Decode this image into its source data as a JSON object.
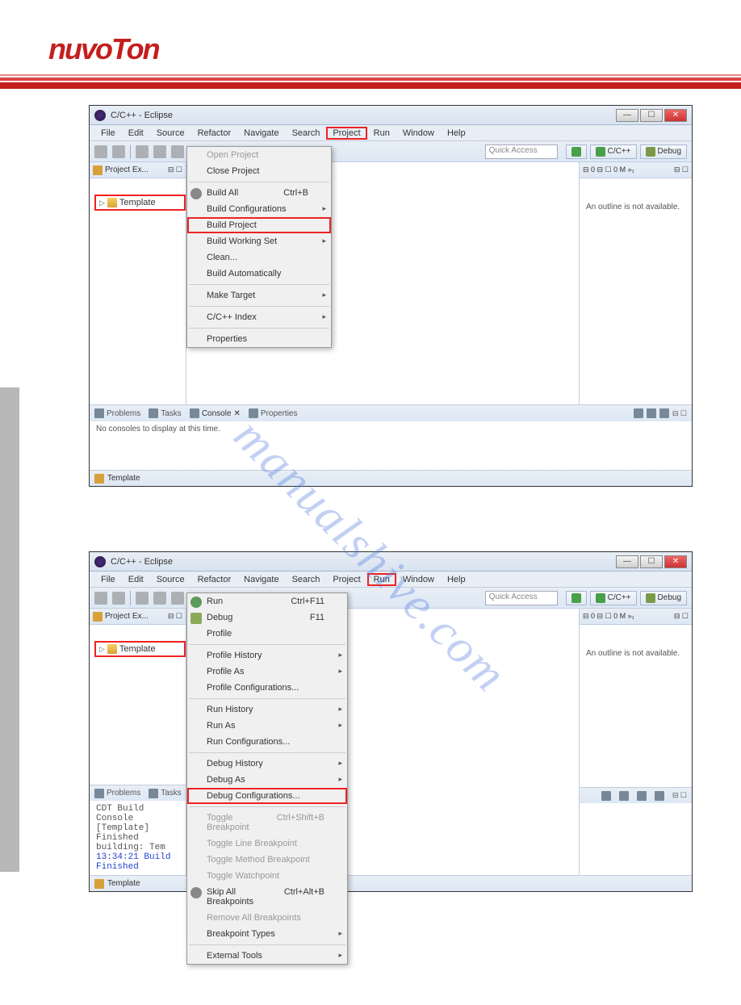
{
  "logo": "nuvoTon",
  "watermark": "manualshive.com",
  "shot1": {
    "title": "C/C++ - Eclipse",
    "menus": [
      "File",
      "Edit",
      "Source",
      "Refactor",
      "Navigate",
      "Search",
      "Project",
      "Run",
      "Window",
      "Help"
    ],
    "highlight_menu": "Project",
    "quick_access": "Quick Access",
    "persp_ccpp": "C/C++",
    "persp_debug": "Debug",
    "proj_explorer": "Project Ex...",
    "tree_item": "Template",
    "outline": "An outline is not available.",
    "tabs": {
      "problems": "Problems",
      "tasks": "Tasks",
      "console": "Console",
      "properties": "Properties"
    },
    "console_txt": "No consoles to display at this time.",
    "status": "Template",
    "dropdown": {
      "items": [
        {
          "label": "Open Project",
          "disabled": true
        },
        {
          "label": "Close Project"
        },
        {
          "sep": true
        },
        {
          "label": "Build All",
          "shortcut": "Ctrl+B",
          "icon": "gear"
        },
        {
          "label": "Build Configurations",
          "submenu": true
        },
        {
          "label": "Build Project",
          "hl": true
        },
        {
          "label": "Build Working Set",
          "submenu": true
        },
        {
          "label": "Clean..."
        },
        {
          "label": "Build Automatically"
        },
        {
          "sep": true
        },
        {
          "label": "Make Target",
          "submenu": true
        },
        {
          "sep": true
        },
        {
          "label": "C/C++ Index",
          "submenu": true
        },
        {
          "sep": true
        },
        {
          "label": "Properties"
        }
      ]
    }
  },
  "shot2": {
    "title": "C/C++ - Eclipse",
    "menus": [
      "File",
      "Edit",
      "Source",
      "Refactor",
      "Navigate",
      "Search",
      "Project",
      "Run",
      "Window",
      "Help"
    ],
    "highlight_menu": "Run",
    "quick_access": "Quick Access",
    "persp_ccpp": "C/C++",
    "persp_debug": "Debug",
    "proj_explorer": "Project Ex...",
    "tree_item": "Template",
    "outline": "An outline is not available.",
    "tabs": {
      "problems": "Problems",
      "tasks": "Tasks"
    },
    "console_lines": [
      {
        "txt": "CDT Build Console [Template]",
        "cls": ""
      },
      {
        "txt": "Finished building: Tem",
        "cls": ""
      },
      {
        "txt": "",
        "cls": ""
      },
      {
        "txt": "13:34:21 Build Finished",
        "cls": "blue"
      }
    ],
    "status": "Template",
    "dropdown": {
      "items": [
        {
          "label": "Run",
          "shortcut": "Ctrl+F11",
          "icon": "gr"
        },
        {
          "label": "Debug",
          "shortcut": "F11",
          "icon": "bug"
        },
        {
          "label": "Profile"
        },
        {
          "sep": true
        },
        {
          "label": "Profile History",
          "submenu": true
        },
        {
          "label": "Profile As",
          "submenu": true
        },
        {
          "label": "Profile Configurations..."
        },
        {
          "sep": true
        },
        {
          "label": "Run History",
          "submenu": true
        },
        {
          "label": "Run As",
          "submenu": true
        },
        {
          "label": "Run Configurations..."
        },
        {
          "sep": true
        },
        {
          "label": "Debug History",
          "submenu": true
        },
        {
          "label": "Debug As",
          "submenu": true
        },
        {
          "label": "Debug Configurations...",
          "hl": true
        },
        {
          "sep": true
        },
        {
          "label": "Toggle Breakpoint",
          "shortcut": "Ctrl+Shift+B",
          "disabled": true
        },
        {
          "label": "Toggle Line Breakpoint",
          "disabled": true
        },
        {
          "label": "Toggle Method Breakpoint",
          "disabled": true
        },
        {
          "label": "Toggle Watchpoint",
          "disabled": true
        },
        {
          "label": "Skip All Breakpoints",
          "shortcut": "Ctrl+Alt+B",
          "icon": "gear"
        },
        {
          "label": "Remove All Breakpoints",
          "disabled": true
        },
        {
          "label": "Breakpoint Types",
          "submenu": true
        },
        {
          "sep": true
        },
        {
          "label": "External Tools",
          "submenu": true
        }
      ]
    }
  }
}
